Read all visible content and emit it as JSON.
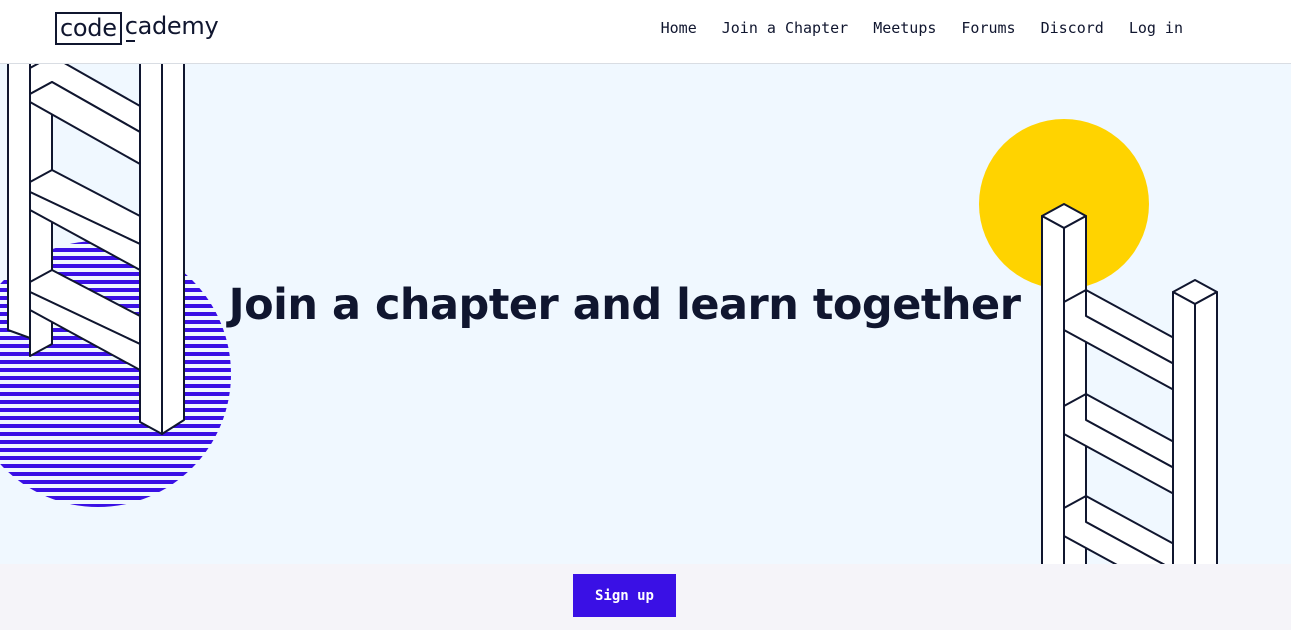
{
  "header": {
    "logo": {
      "part1": "code",
      "part2": "cademy"
    },
    "nav": [
      {
        "label": "Home"
      },
      {
        "label": "Join a Chapter"
      },
      {
        "label": "Meetups"
      },
      {
        "label": "Forums"
      },
      {
        "label": "Discord"
      },
      {
        "label": "Log in"
      }
    ]
  },
  "hero": {
    "title": "Join a chapter and learn together"
  },
  "cta": {
    "signup_label": "Sign up"
  },
  "colors": {
    "navy": "#10162f",
    "hero_bg": "#f0f8ff",
    "accent_purple": "#3a10e5",
    "sun_yellow": "#ffd300",
    "footer_bg": "#f5f4f9"
  },
  "icons": [
    "ladder-left-illustration",
    "ladder-right-illustration",
    "striped-circle-decoration",
    "yellow-sun-decoration"
  ]
}
